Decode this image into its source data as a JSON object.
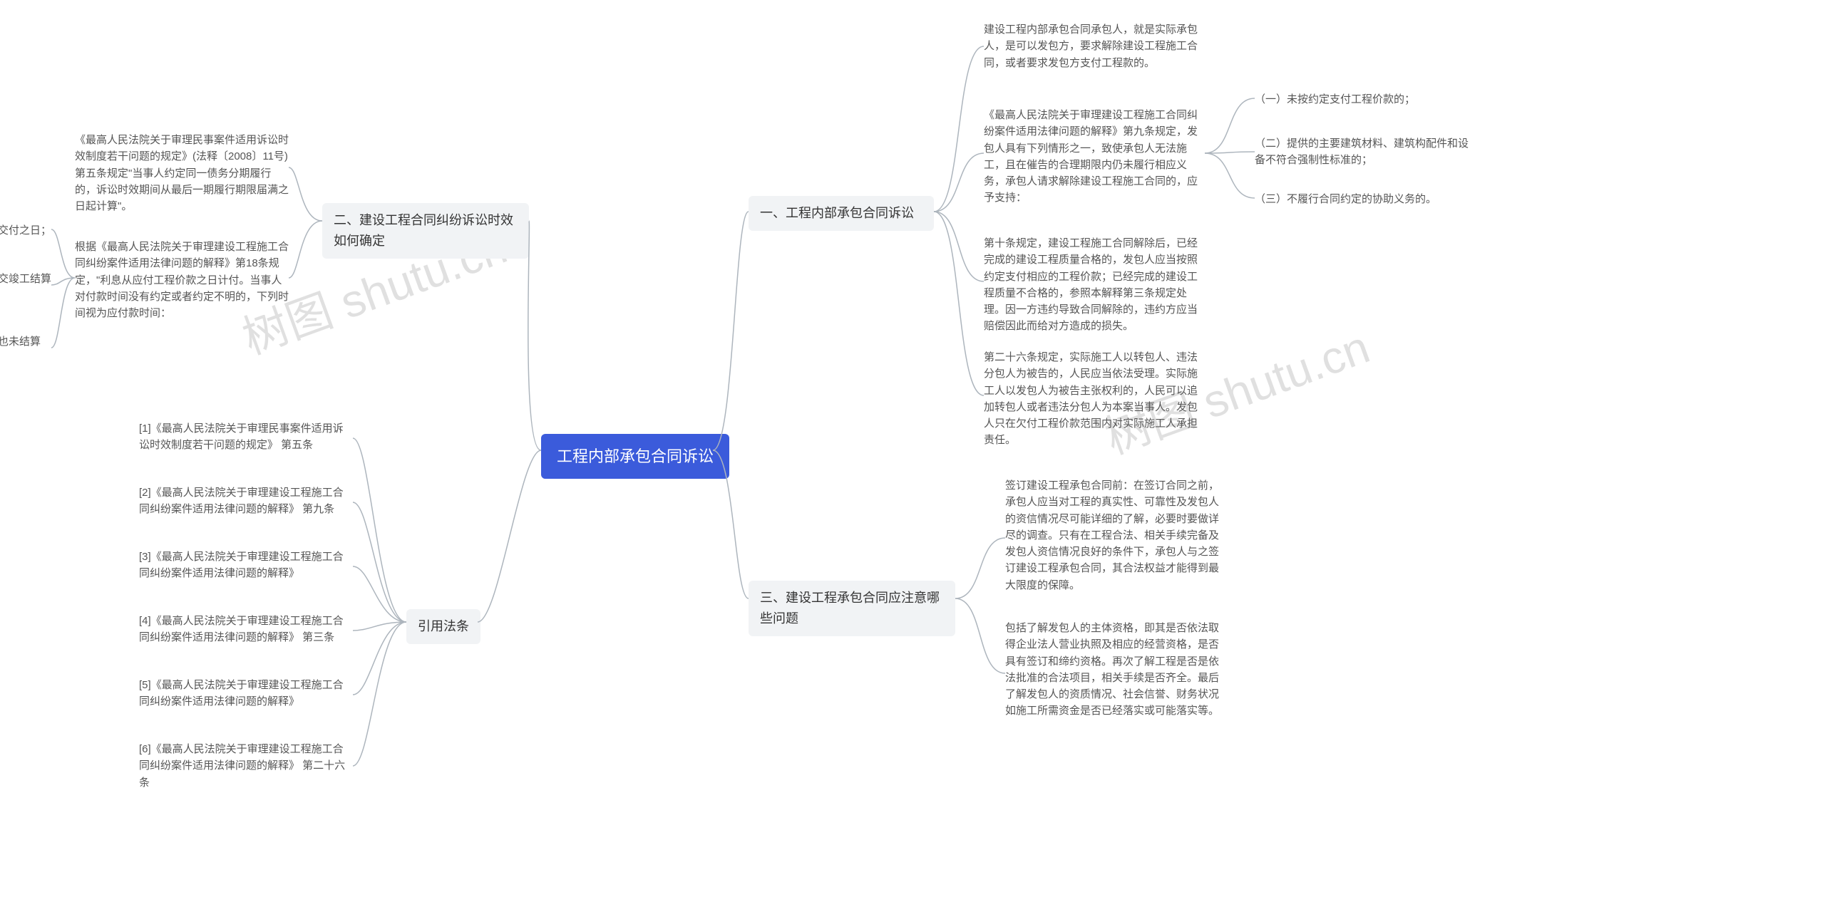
{
  "root": {
    "title": "工程内部承包合同诉讼"
  },
  "watermark": "树图 shutu.cn",
  "right": {
    "section1": {
      "title": "一、工程内部承包合同诉讼",
      "items": [
        "建设工程内部承包合同承包人，就是实际承包人，是可以发包方，要求解除建设工程施工合同，或者要求发包方支付工程款的。",
        "《最高人民法院关于审理建设工程施工合同纠纷案件适用法律问题的解释》第九条规定，发包人具有下列情形之一，致使承包人无法施工，且在催告的合理期限内仍未履行相应义务，承包人请求解除建设工程施工合同的，应予支持：",
        "第十条规定，建设工程施工合同解除后，已经完成的建设工程质量合格的，发包人应当按照约定支付相应的工程价款；已经完成的建设工程质量不合格的，参照本解释第三条规定处理。因一方违约导致合同解除的，违约方应当赔偿因此而给对方造成的损失。",
        "第二十六条规定，实际施工人以转包人、违法分包人为被告的，人民应当依法受理。实际施工人以发包人为被告主张权利的，人民可以追加转包人或者违法分包人为本案当事人。发包人只在欠付工程价款范围内对实际施工人承担责任。"
      ],
      "subitems": [
        "（一）未按约定支付工程价款的；",
        "（二）提供的主要建筑材料、建筑构配件和设备不符合强制性标准的；",
        "（三）不履行合同约定的协助义务的。"
      ]
    },
    "section3": {
      "title": "三、建设工程承包合同应注意哪些问题",
      "items": [
        "签订建设工程承包合同前：在签订合同之前，承包人应当对工程的真实性、可靠性及发包人的资信情况尽可能详细的了解，必要时要做详尽的调查。只有在工程合法、相关手续完备及发包人资信情况良好的条件下，承包人与之签订建设工程承包合同，其合法权益才能得到最大限度的保障。",
        "包括了解发包人的主体资格，即其是否依法取得企业法人营业执照及相应的经营资格，是否具有签订和缔约资格。再次了解工程是否是依法批准的合法项目，相关手续是否齐全。最后了解发包人的资质情况、社会信誉、财务状况如施工所需资金是否已经落实或可能落实等。"
      ]
    }
  },
  "left": {
    "section2": {
      "title": "二、建设工程合同纠纷诉讼时效如何确定",
      "items": [
        "《最高人民法院关于审理民事案件适用诉讼时效制度若干问题的规定》(法释〔2008〕11号)第五条规定\"当事人约定同一债务分期履行的，诉讼时效期间从最后一期履行期限届满之日起计算\"。",
        "根据《最高人民法院关于审理建设工程施工合同纠纷案件适用法律问题的解释》第18条规定，\"利息从应付工程价款之日计付。当事人对付款时间没有约定或者约定不明的，下列时间视为应付款时间："
      ],
      "subitems": [
        "（一）建设工程已实际交付的，为交付之日；",
        "（二）建设工程没有交付的，为提交竣工结算文件之日；",
        "（三）建设工程未交付，工程价款也未结算的，为当事人起诉之日。"
      ]
    },
    "section_ref": {
      "title": "引用法条",
      "items": [
        "[1]《最高人民法院关于审理民事案件适用诉讼时效制度若干问题的规定》 第五条",
        "[2]《最高人民法院关于审理建设工程施工合同纠纷案件适用法律问题的解释》 第九条",
        "[3]《最高人民法院关于审理建设工程施工合同纠纷案件适用法律问题的解释》",
        "[4]《最高人民法院关于审理建设工程施工合同纠纷案件适用法律问题的解释》 第三条",
        "[5]《最高人民法院关于审理建设工程施工合同纠纷案件适用法律问题的解释》",
        "[6]《最高人民法院关于审理建设工程施工合同纠纷案件适用法律问题的解释》 第二十六条"
      ]
    }
  }
}
